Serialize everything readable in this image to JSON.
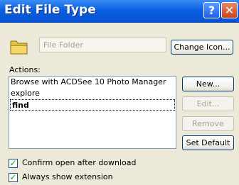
{
  "window": {
    "title": "Edit File Type",
    "help_glyph": "?",
    "close_glyph": "✕"
  },
  "file_type": {
    "name_value": "File Folder",
    "icon": "folder-icon",
    "change_icon_label": "Change Icon..."
  },
  "actions": {
    "label": "Actions:",
    "items": [
      {
        "label": "Browse with ACDSee 10 Photo Manager",
        "selected": false
      },
      {
        "label": "explore",
        "selected": false
      },
      {
        "label": "find",
        "selected": true
      }
    ]
  },
  "buttons": {
    "new_label": "New...",
    "edit_label": "Edit...",
    "remove_label": "Remove",
    "set_default_label": "Set Default"
  },
  "options": {
    "confirm_open": {
      "label": "Confirm open after download",
      "checked": true
    },
    "always_show_ext": {
      "label": "Always show extension",
      "checked": true
    }
  },
  "colors": {
    "titlebar": "#0a5fe0",
    "dialog_bg": "#ece9d8",
    "close_button": "#c9431c",
    "checkmark": "#21a121"
  }
}
